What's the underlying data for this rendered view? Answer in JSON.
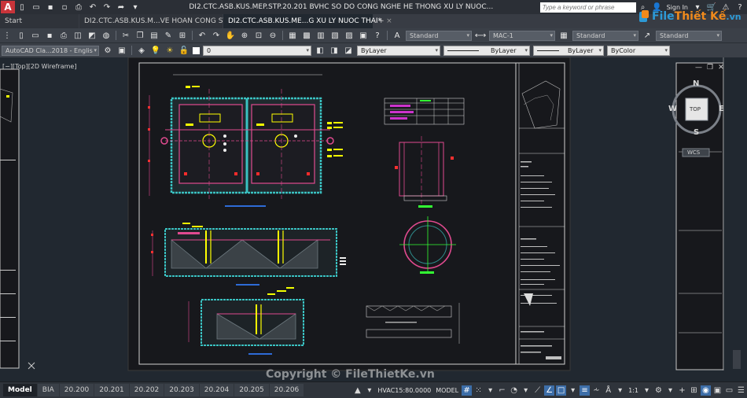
{
  "window": {
    "title": "DI2.CTC.ASB.KUS.MEP.STP.20.201 BVHC SO DO CONG NGHE HE THONG XU LY NUOC...",
    "search_placeholder": "Type a keyword or phrase",
    "sign_in": "Sign In",
    "app_letter": "A"
  },
  "tabs": [
    {
      "label": "Start",
      "active": false
    },
    {
      "label": "DI2.CTC.ASB.KUS.M...VE HOAN CONG STP*",
      "active": false
    },
    {
      "label": "DI2.CTC.ASB.KUS.ME...G XU LY NUOC THAI*",
      "active": true
    }
  ],
  "ribbon": {
    "text_style": "Standard",
    "dim_style": "MAC-1",
    "table_style": "Standard",
    "mleader_style": "Standard",
    "workspace": "AutoCAD Cla...2018 - Englis",
    "layer": "0",
    "color": "ByLayer",
    "linetype": "ByLayer",
    "lineweight": "ByLayer",
    "plotstyle": "ByColor"
  },
  "viewport": {
    "label": "[−][Top][2D Wireframe]"
  },
  "navcube": {
    "north": "N",
    "south": "S",
    "east": "E",
    "west": "W",
    "face": "TOP",
    "ucs": "WCS"
  },
  "logo": {
    "part1": "File",
    "part2": "Thiết Kế",
    "part3": ".vn"
  },
  "layouts": [
    {
      "label": "Model",
      "active": true
    },
    {
      "label": "BIA",
      "active": false
    },
    {
      "label": "20.200",
      "active": false
    },
    {
      "label": "20.201",
      "active": false
    },
    {
      "label": "20.202",
      "active": false
    },
    {
      "label": "20.203",
      "active": false
    },
    {
      "label": "20.204",
      "active": false
    },
    {
      "label": "20.205",
      "active": false
    },
    {
      "label": "20.206",
      "active": false
    }
  ],
  "status": {
    "dim_scale": "HVAC15:80.0000",
    "space": "MODEL",
    "annoscale": "1:1"
  },
  "watermark": "Copyright © FileThietKe.vn"
}
